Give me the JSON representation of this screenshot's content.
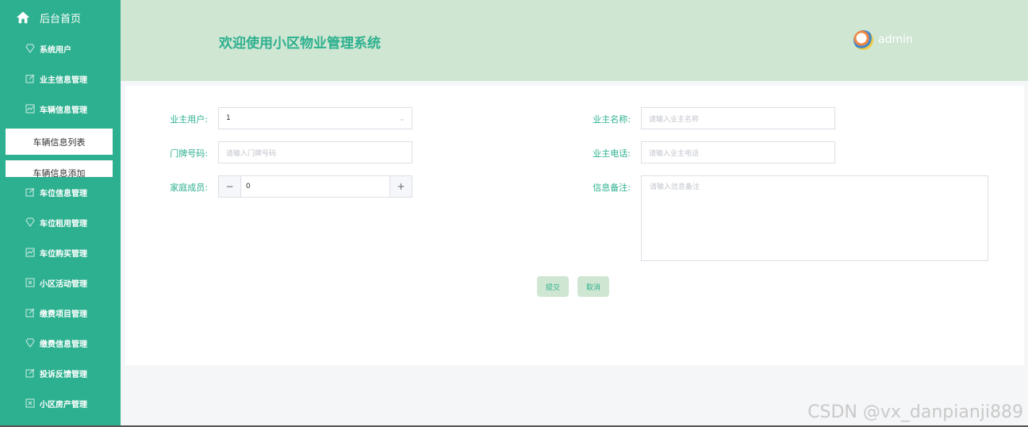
{
  "sidebar": {
    "home_label": "后台首页",
    "items": [
      {
        "label": "系统用户",
        "icon": "gem-icon"
      },
      {
        "label": "业主信息管理",
        "icon": "edit-icon"
      },
      {
        "label": "车辆信息管理",
        "icon": "chart-icon"
      },
      {
        "label": "车位信息管理",
        "icon": "edit-icon"
      },
      {
        "label": "车位租用管理",
        "icon": "gem-icon"
      },
      {
        "label": "车位购买管理",
        "icon": "chart-icon"
      },
      {
        "label": "小区活动管理",
        "icon": "doc-icon"
      },
      {
        "label": "缴费项目管理",
        "icon": "edit-icon"
      },
      {
        "label": "缴费信息管理",
        "icon": "gem-icon"
      },
      {
        "label": "投诉反馈管理",
        "icon": "edit-icon"
      },
      {
        "label": "小区房产管理",
        "icon": "doc-icon"
      }
    ],
    "sub_items": [
      {
        "label": "车辆信息列表"
      },
      {
        "label": "车辆信息添加"
      }
    ]
  },
  "header": {
    "title": "欢迎使用小区物业管理系统",
    "user": "admin"
  },
  "form": {
    "owner_user": {
      "label": "业主用户:",
      "value": "1"
    },
    "owner_name": {
      "label": "业主名称:",
      "placeholder": "请输入业主名称"
    },
    "door_no": {
      "label": "门牌号码:",
      "placeholder": "请输入门牌号码"
    },
    "owner_phone": {
      "label": "业主电话:",
      "placeholder": "请输入业主电话"
    },
    "family": {
      "label": "家庭成员:",
      "value": "0",
      "minus": "−",
      "plus": "+"
    },
    "remark": {
      "label": "信息备注:",
      "placeholder": "请输入信息备注"
    },
    "submit": "提交",
    "cancel": "取消"
  },
  "watermark": "CSDN @vx_danpianji889",
  "colors": {
    "accent": "#2db08f",
    "header_bg": "#cfe6d2"
  }
}
